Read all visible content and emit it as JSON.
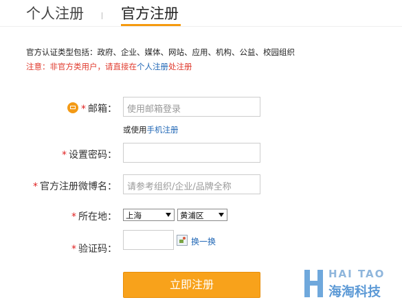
{
  "tabs": {
    "personal": "个人注册",
    "official": "官方注册"
  },
  "notes": {
    "types": "官方认证类型包括：政府、企业、媒体、网站、应用、机构、公益、校园组织",
    "notice_prefix": "注意：非官方类用户，请直接在",
    "notice_link": "个人注册",
    "notice_suffix": "处注册"
  },
  "form": {
    "required_mark": "*",
    "email_label": "邮箱：",
    "email_placeholder": "使用邮箱登录",
    "phone_alt_prefix": "或使用",
    "phone_alt_link": "手机注册",
    "password_label": "设置密码：",
    "password_value": "",
    "name_label": "官方注册微博名：",
    "name_placeholder": "请参考组织/企业/品牌全称",
    "location_label": "所在地：",
    "province": "上海",
    "district": "黄浦区",
    "captcha_label": "验证码：",
    "captcha_value": "",
    "captcha_refresh": "换一换",
    "submit": "立即注册"
  },
  "icons": {
    "email": "envelope-icon",
    "captcha_image": "broken-image-icon"
  },
  "watermark": {
    "en": "HAI TAO",
    "cn": "海淘科技"
  },
  "colors": {
    "accent": "#f59a0e",
    "required": "#e02020",
    "link": "#2268b6",
    "notice": "#e03b2e"
  }
}
